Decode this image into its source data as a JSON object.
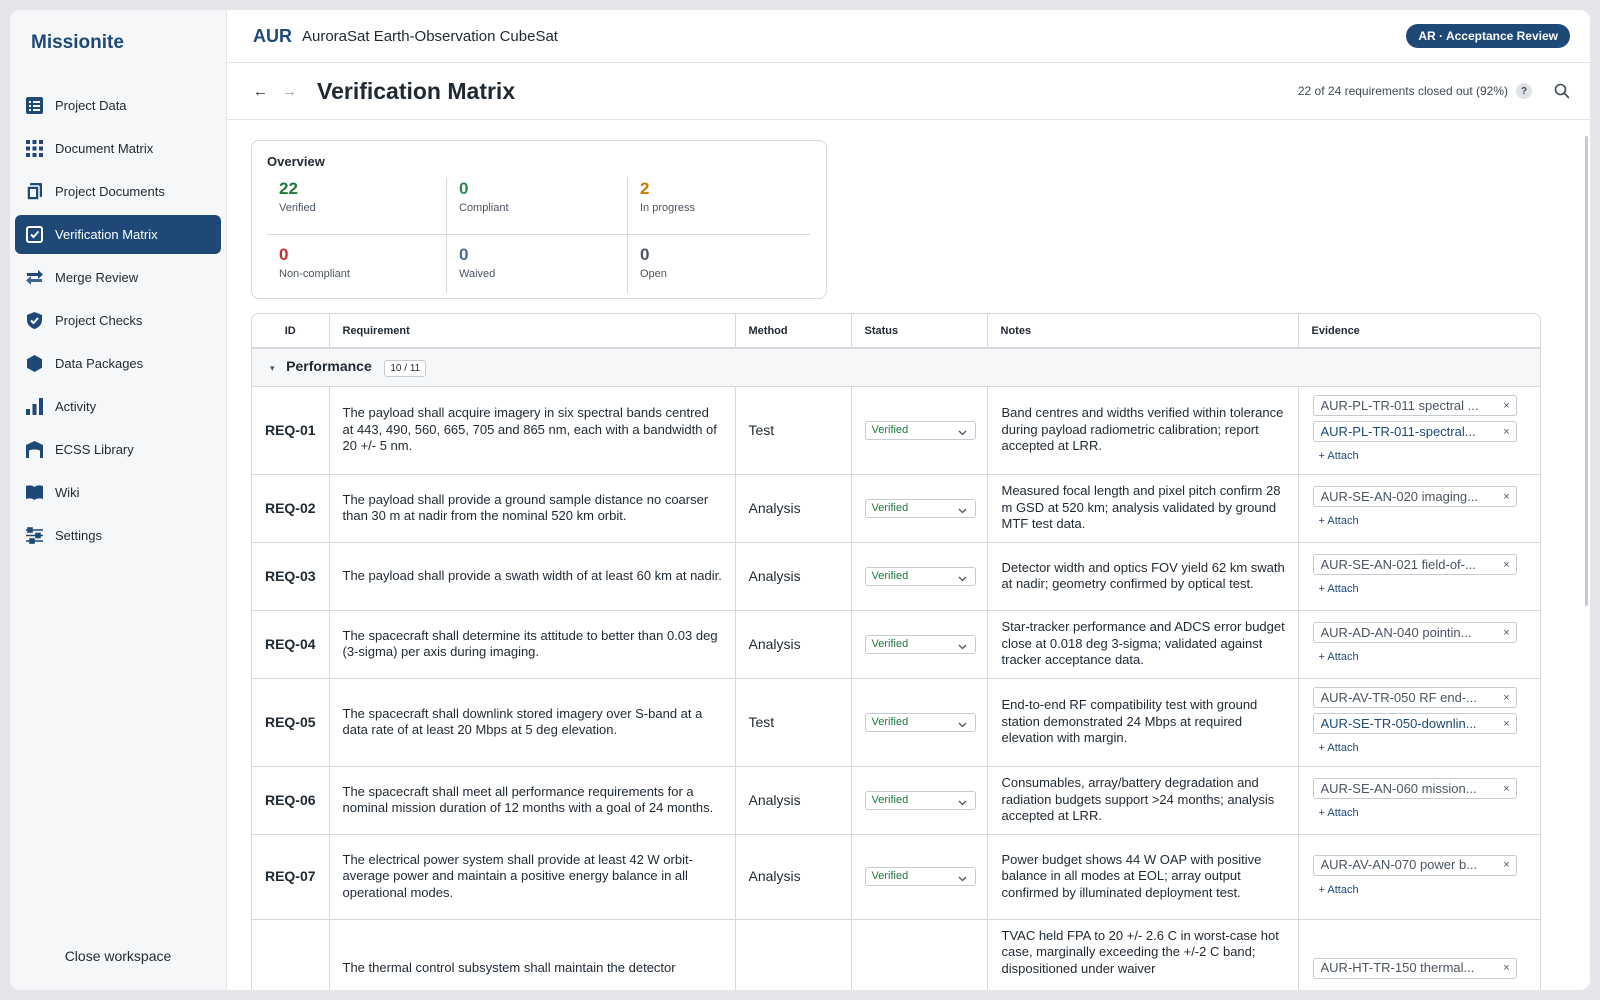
{
  "brand": "Missionite",
  "nav": [
    {
      "label": "Project Data",
      "icon": "list-icon"
    },
    {
      "label": "Document Matrix",
      "icon": "grid-icon"
    },
    {
      "label": "Project Documents",
      "icon": "documents-icon"
    },
    {
      "label": "Verification Matrix",
      "icon": "checkbox-icon",
      "active": true
    },
    {
      "label": "Merge Review",
      "icon": "merge-arrows-icon"
    },
    {
      "label": "Project Checks",
      "icon": "shield-check-icon"
    },
    {
      "label": "Data Packages",
      "icon": "hexagon-icon"
    },
    {
      "label": "Activity",
      "icon": "bar-chart-icon"
    },
    {
      "label": "ECSS Library",
      "icon": "library-icon"
    },
    {
      "label": "Wiki",
      "icon": "book-icon"
    },
    {
      "label": "Settings",
      "icon": "sliders-icon"
    }
  ],
  "close_workspace": "Close workspace",
  "header": {
    "project_code": "AUR",
    "project_name": "AuroraSat Earth-Observation CubeSat",
    "phase_badge": "AR · Acceptance Review"
  },
  "titlebar": {
    "back_arrow": "←",
    "forward_arrow": "→",
    "title": "Verification Matrix",
    "progress": "22 of 24 requirements closed out (92%)",
    "help": "?"
  },
  "overview": {
    "title": "Overview",
    "stats": [
      {
        "value": "22",
        "label": "Verified",
        "color": "#1e7a3c"
      },
      {
        "value": "0",
        "label": "Compliant",
        "color": "#2a8a52"
      },
      {
        "value": "2",
        "label": "In progress",
        "color": "#c77a00"
      },
      {
        "value": "0",
        "label": "Non-compliant",
        "color": "#c53030"
      },
      {
        "value": "0",
        "label": "Waived",
        "color": "#4a6a8a"
      },
      {
        "value": "0",
        "label": "Open",
        "color": "#4b5561"
      }
    ]
  },
  "table": {
    "columns": [
      "ID",
      "Requirement",
      "Method",
      "Status",
      "Notes",
      "Evidence"
    ],
    "group": {
      "caret": "▾",
      "name": "Performance",
      "count": "10 / 11"
    },
    "attach_label": "+ Attach",
    "remove_glyph": "×",
    "rows": [
      {
        "id": "REQ-01",
        "requirement": "The payload shall acquire imagery in six spectral bands centred at 443, 490, 560, 665, 705 and 865 nm, each with a bandwidth of 20 +/- 5 nm.",
        "method": "Test",
        "status": "Verified",
        "notes": "Band centres and widths verified within tolerance during payload radiometric calibration; report accepted at LRR.",
        "evidence": [
          {
            "text": "AUR-PL-TR-011 spectral ...",
            "style": "grey"
          },
          {
            "text": "AUR-PL-TR-011-spectral...",
            "style": "blue"
          }
        ]
      },
      {
        "id": "REQ-02",
        "requirement": "The payload shall provide a ground sample distance no coarser than 30 m at nadir from the nominal 520 km orbit.",
        "method": "Analysis",
        "status": "Verified",
        "notes": "Measured focal length and pixel pitch confirm 28 m GSD at 520 km; analysis validated by ground MTF test data.",
        "evidence": [
          {
            "text": "AUR-SE-AN-020 imaging...",
            "style": "grey"
          }
        ]
      },
      {
        "id": "REQ-03",
        "requirement": "The payload shall provide a swath width of at least 60 km at nadir.",
        "method": "Analysis",
        "status": "Verified",
        "notes": "Detector width and optics FOV yield 62 km swath at nadir; geometry confirmed by optical test.",
        "evidence": [
          {
            "text": "AUR-SE-AN-021 field-of-...",
            "style": "grey"
          }
        ]
      },
      {
        "id": "REQ-04",
        "requirement": "The spacecraft shall determine its attitude to better than 0.03 deg (3-sigma) per axis during imaging.",
        "method": "Analysis",
        "status": "Verified",
        "notes": "Star-tracker performance and ADCS error budget close at 0.018 deg 3-sigma; validated against tracker acceptance data.",
        "evidence": [
          {
            "text": "AUR-AD-AN-040 pointin...",
            "style": "grey"
          }
        ]
      },
      {
        "id": "REQ-05",
        "requirement": "The spacecraft shall downlink stored imagery over S-band at a data rate of at least 20 Mbps at 5 deg elevation.",
        "method": "Test",
        "status": "Verified",
        "notes": "End-to-end RF compatibility test with ground station demonstrated 24 Mbps at required elevation with margin.",
        "evidence": [
          {
            "text": "AUR-AV-TR-050 RF end-...",
            "style": "grey"
          },
          {
            "text": "AUR-SE-TR-050-downlin...",
            "style": "blue"
          }
        ]
      },
      {
        "id": "REQ-06",
        "requirement": "The spacecraft shall meet all performance requirements for a nominal mission duration of 12 months with a goal of 24 months.",
        "method": "Analysis",
        "status": "Verified",
        "notes": "Consumables, array/battery degradation and radiation budgets support >24 months; analysis accepted at LRR.",
        "evidence": [
          {
            "text": "AUR-SE-AN-060 mission...",
            "style": "grey"
          }
        ]
      },
      {
        "id": "REQ-07",
        "requirement": "The electrical power system shall provide at least 42 W orbit-average power and maintain a positive energy balance in all operational modes.",
        "method": "Analysis",
        "status": "Verified",
        "notes": "Power budget shows 44 W OAP with positive balance in all modes at EOL; array output confirmed by illuminated deployment test.",
        "evidence": [
          {
            "text": "AUR-AV-AN-070 power b...",
            "style": "grey"
          }
        ]
      },
      {
        "id": "",
        "requirement": "The thermal control subsystem shall maintain the detector",
        "method": "",
        "status": "",
        "notes": "TVAC held FPA to 20 +/- 2.6 C in worst-case hot case, marginally exceeding the +/-2 C band; dispositioned under waiver",
        "evidence": [
          {
            "text": "AUR-HT-TR-150 thermal...",
            "style": "grey"
          }
        ]
      }
    ]
  }
}
